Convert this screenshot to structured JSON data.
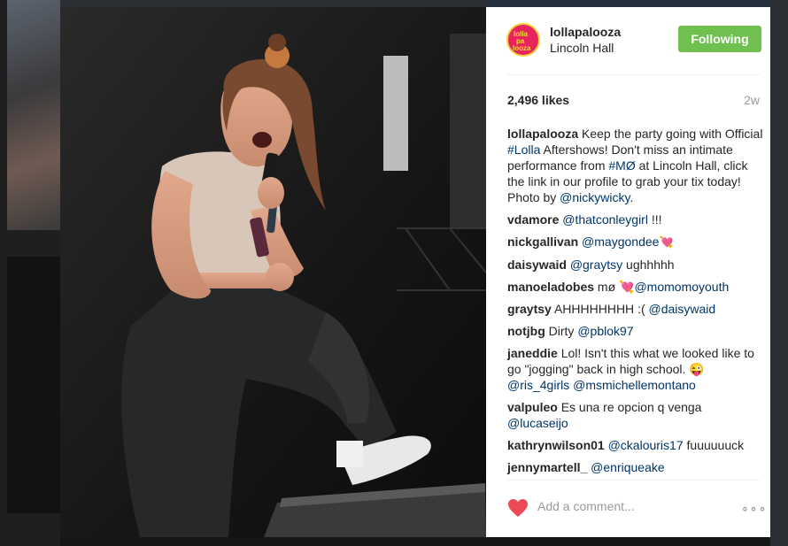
{
  "post": {
    "username": "lollapalooza",
    "location": "Lincoln Hall",
    "follow_label": "Following",
    "likes": "2,496 likes",
    "age": "2w",
    "avatar_text": [
      "lolla",
      "pa",
      "looza"
    ]
  },
  "caption": {
    "user": "lollapalooza",
    "text_1": "Keep the party going with Official ",
    "hashtag_1": "#Lolla",
    "text_2": " Aftershows! Don't miss an intimate performance from ",
    "hashtag_2": "#MØ",
    "text_3": " at Lincoln Hall, click the link in our profile to grab your tix today! Photo by ",
    "mention": "@nickywicky",
    "text_4": "."
  },
  "comments": [
    {
      "user": "vdamore",
      "text_pre": "",
      "mention": "@thatconleygirl",
      "text_post": " !!!"
    },
    {
      "user": "nickgallivan",
      "text_pre": "",
      "mention": "@maygondee",
      "text_post": " 💘"
    },
    {
      "user": "daisywaid",
      "text_pre": "",
      "mention": "@graytsy",
      "text_post": " ughhhhh"
    },
    {
      "user": "manoeladobes",
      "text_pre": "mø 💘",
      "mention": "@momomoyouth",
      "text_post": ""
    },
    {
      "user": "graytsy",
      "text_pre": "AHHHHHHHH :( ",
      "mention": "@daisywaid",
      "text_post": ""
    },
    {
      "user": "notjbg",
      "text_pre": "Dirty ",
      "mention": "@pblok97",
      "text_post": ""
    },
    {
      "user": "janeddie",
      "text_pre": "Lol! Isn't this what we looked like to go \"jogging\" back in high school. 😜 ",
      "mention": "@ris_4girls",
      "mention2": "@msmichellemontano",
      "text_post": ""
    },
    {
      "user": "valpuleo",
      "text_pre": "Es una re opcion q venga ",
      "mention": "@lucaseijo",
      "text_post": ""
    },
    {
      "user": "kathrynwilson01",
      "text_pre": "",
      "mention": "@ckalouris17",
      "text_post": " fuuuuuuck"
    },
    {
      "user": "jennymartell_",
      "text_pre": "",
      "mention": "@enriqueake",
      "text_post": ""
    }
  ],
  "footer": {
    "add_comment_placeholder": "Add a comment...",
    "more_label": "∘∘∘",
    "heart_icon": "heart-icon"
  },
  "colors": {
    "follow_button": "#70c050",
    "link": "#003569",
    "heart": "#ed4956"
  }
}
